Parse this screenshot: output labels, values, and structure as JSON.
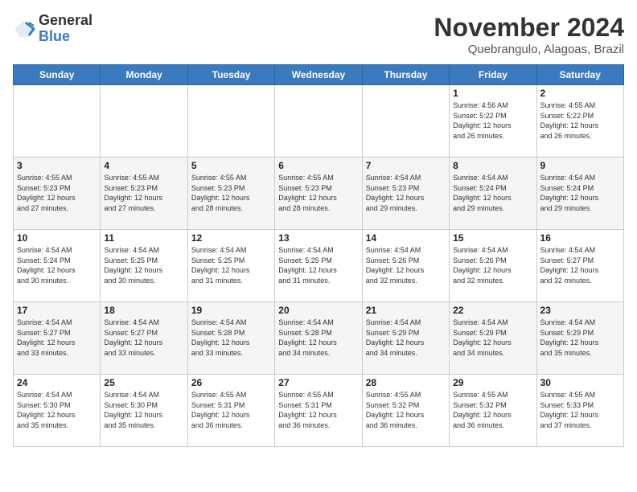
{
  "logo": {
    "general": "General",
    "blue": "Blue"
  },
  "title": "November 2024",
  "location": "Quebrangulo, Alagoas, Brazil",
  "weekdays": [
    "Sunday",
    "Monday",
    "Tuesday",
    "Wednesday",
    "Thursday",
    "Friday",
    "Saturday"
  ],
  "weeks": [
    [
      {
        "day": "",
        "info": ""
      },
      {
        "day": "",
        "info": ""
      },
      {
        "day": "",
        "info": ""
      },
      {
        "day": "",
        "info": ""
      },
      {
        "day": "",
        "info": ""
      },
      {
        "day": "1",
        "info": "Sunrise: 4:56 AM\nSunset: 5:22 PM\nDaylight: 12 hours\nand 26 minutes."
      },
      {
        "day": "2",
        "info": "Sunrise: 4:55 AM\nSunset: 5:22 PM\nDaylight: 12 hours\nand 26 minutes."
      }
    ],
    [
      {
        "day": "3",
        "info": "Sunrise: 4:55 AM\nSunset: 5:23 PM\nDaylight: 12 hours\nand 27 minutes."
      },
      {
        "day": "4",
        "info": "Sunrise: 4:55 AM\nSunset: 5:23 PM\nDaylight: 12 hours\nand 27 minutes."
      },
      {
        "day": "5",
        "info": "Sunrise: 4:55 AM\nSunset: 5:23 PM\nDaylight: 12 hours\nand 28 minutes."
      },
      {
        "day": "6",
        "info": "Sunrise: 4:55 AM\nSunset: 5:23 PM\nDaylight: 12 hours\nand 28 minutes."
      },
      {
        "day": "7",
        "info": "Sunrise: 4:54 AM\nSunset: 5:23 PM\nDaylight: 12 hours\nand 29 minutes."
      },
      {
        "day": "8",
        "info": "Sunrise: 4:54 AM\nSunset: 5:24 PM\nDaylight: 12 hours\nand 29 minutes."
      },
      {
        "day": "9",
        "info": "Sunrise: 4:54 AM\nSunset: 5:24 PM\nDaylight: 12 hours\nand 29 minutes."
      }
    ],
    [
      {
        "day": "10",
        "info": "Sunrise: 4:54 AM\nSunset: 5:24 PM\nDaylight: 12 hours\nand 30 minutes."
      },
      {
        "day": "11",
        "info": "Sunrise: 4:54 AM\nSunset: 5:25 PM\nDaylight: 12 hours\nand 30 minutes."
      },
      {
        "day": "12",
        "info": "Sunrise: 4:54 AM\nSunset: 5:25 PM\nDaylight: 12 hours\nand 31 minutes."
      },
      {
        "day": "13",
        "info": "Sunrise: 4:54 AM\nSunset: 5:25 PM\nDaylight: 12 hours\nand 31 minutes."
      },
      {
        "day": "14",
        "info": "Sunrise: 4:54 AM\nSunset: 5:26 PM\nDaylight: 12 hours\nand 32 minutes."
      },
      {
        "day": "15",
        "info": "Sunrise: 4:54 AM\nSunset: 5:26 PM\nDaylight: 12 hours\nand 32 minutes."
      },
      {
        "day": "16",
        "info": "Sunrise: 4:54 AM\nSunset: 5:27 PM\nDaylight: 12 hours\nand 32 minutes."
      }
    ],
    [
      {
        "day": "17",
        "info": "Sunrise: 4:54 AM\nSunset: 5:27 PM\nDaylight: 12 hours\nand 33 minutes."
      },
      {
        "day": "18",
        "info": "Sunrise: 4:54 AM\nSunset: 5:27 PM\nDaylight: 12 hours\nand 33 minutes."
      },
      {
        "day": "19",
        "info": "Sunrise: 4:54 AM\nSunset: 5:28 PM\nDaylight: 12 hours\nand 33 minutes."
      },
      {
        "day": "20",
        "info": "Sunrise: 4:54 AM\nSunset: 5:28 PM\nDaylight: 12 hours\nand 34 minutes."
      },
      {
        "day": "21",
        "info": "Sunrise: 4:54 AM\nSunset: 5:29 PM\nDaylight: 12 hours\nand 34 minutes."
      },
      {
        "day": "22",
        "info": "Sunrise: 4:54 AM\nSunset: 5:29 PM\nDaylight: 12 hours\nand 34 minutes."
      },
      {
        "day": "23",
        "info": "Sunrise: 4:54 AM\nSunset: 5:29 PM\nDaylight: 12 hours\nand 35 minutes."
      }
    ],
    [
      {
        "day": "24",
        "info": "Sunrise: 4:54 AM\nSunset: 5:30 PM\nDaylight: 12 hours\nand 35 minutes."
      },
      {
        "day": "25",
        "info": "Sunrise: 4:54 AM\nSunset: 5:30 PM\nDaylight: 12 hours\nand 35 minutes."
      },
      {
        "day": "26",
        "info": "Sunrise: 4:55 AM\nSunset: 5:31 PM\nDaylight: 12 hours\nand 36 minutes."
      },
      {
        "day": "27",
        "info": "Sunrise: 4:55 AM\nSunset: 5:31 PM\nDaylight: 12 hours\nand 36 minutes."
      },
      {
        "day": "28",
        "info": "Sunrise: 4:55 AM\nSunset: 5:32 PM\nDaylight: 12 hours\nand 36 minutes."
      },
      {
        "day": "29",
        "info": "Sunrise: 4:55 AM\nSunset: 5:32 PM\nDaylight: 12 hours\nand 36 minutes."
      },
      {
        "day": "30",
        "info": "Sunrise: 4:55 AM\nSunset: 5:33 PM\nDaylight: 12 hours\nand 37 minutes."
      }
    ]
  ]
}
